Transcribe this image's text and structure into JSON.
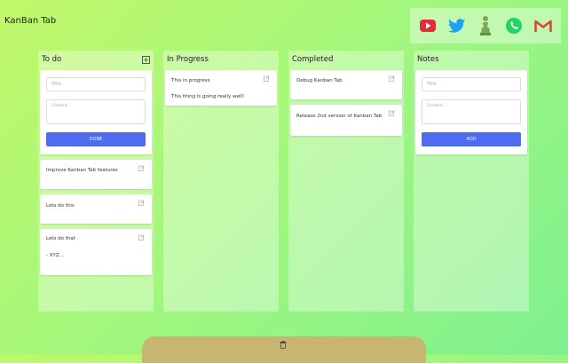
{
  "app": {
    "title": "KanBan Tab"
  },
  "social": [
    {
      "name": "youtube-icon",
      "color": "#e62b3a"
    },
    {
      "name": "twitter-icon",
      "color": "#1da1f2"
    },
    {
      "name": "chess-icon",
      "color": "#7fa650"
    },
    {
      "name": "whatsapp-icon",
      "color": "#25d366"
    },
    {
      "name": "gmail-icon",
      "color": "#e34133"
    }
  ],
  "columns": {
    "todo": {
      "title": "To do",
      "form": {
        "title_placeholder": "Title",
        "content_placeholder": "Content...",
        "button": "DONE"
      },
      "cards": [
        {
          "title": "Improve Kanban Tab features"
        },
        {
          "title": "Lets do this"
        },
        {
          "title": "Lets do that",
          "content": "- XYZ..."
        }
      ]
    },
    "in_progress": {
      "title": "In Progress",
      "cards": [
        {
          "title": "This in progress",
          "content": "This thing is going really well!"
        }
      ]
    },
    "completed": {
      "title": "Completed",
      "cards": [
        {
          "title": "Debug Kanban Tab"
        },
        {
          "title": "Release 2nd version of Kanban Tab"
        }
      ]
    },
    "notes": {
      "title": "Notes",
      "form": {
        "title_placeholder": "Title",
        "content_placeholder": "Content...",
        "button": "ADD"
      }
    }
  },
  "colors": {
    "accent_button": "#4d6cf0",
    "trash_bar": "#c9b572"
  }
}
